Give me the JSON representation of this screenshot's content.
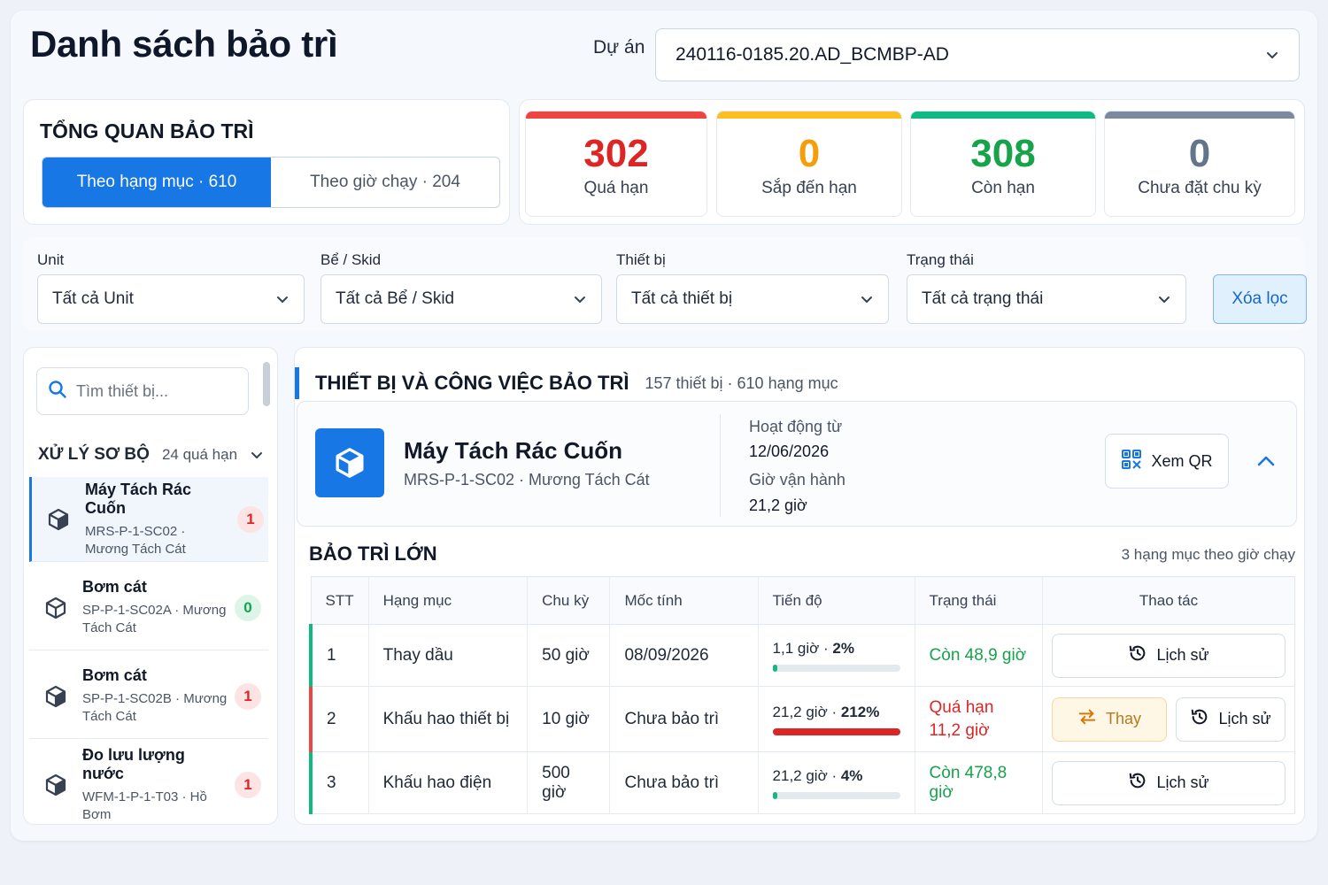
{
  "header": {
    "title": "Danh sách bảo trì",
    "project_label": "Dự án",
    "project_value": "240116-0185.20.AD_BCMBP-AD"
  },
  "overview": {
    "title": "TỔNG QUAN BẢO TRÌ",
    "tab_active": "Theo hạng mục · 610",
    "tab_inactive": "Theo giờ chạy · 204"
  },
  "stats": [
    {
      "value": "302",
      "label": "Quá hạn",
      "color": "#dc2626",
      "bar": "#ef4444"
    },
    {
      "value": "0",
      "label": "Sắp đến hạn",
      "color": "#f59e0b",
      "bar": "#fbbf24"
    },
    {
      "value": "308",
      "label": "Còn hạn",
      "color": "#16a34a",
      "bar": "#10b981"
    },
    {
      "value": "0",
      "label": "Chưa đặt chu kỳ",
      "color": "#64748b",
      "bar": "#7c8a9e"
    }
  ],
  "filters": {
    "unit_label": "Unit",
    "unit_value": "Tất cả Unit",
    "skid_label": "Bể / Skid",
    "skid_value": "Tất cả Bể / Skid",
    "device_label": "Thiết bị",
    "device_value": "Tất cả thiết bị",
    "status_label": "Trạng thái",
    "status_value": "Tất cả trạng thái",
    "clear_label": "Xóa lọc"
  },
  "sidebar": {
    "search_placeholder": "Tìm thiết bị...",
    "group_title": "XỬ LÝ SƠ BỘ",
    "group_count": "24 quá hạn",
    "items": [
      {
        "name": "Máy Tách Rác Cuốn",
        "sub": "MRS-P-1-SC02 · Mương Tách Cát",
        "badge": "1"
      },
      {
        "name": "Bơm cát",
        "sub": "SP-P-1-SC02A · Mương Tách Cát",
        "badge": "0"
      },
      {
        "name": "Bơm cát",
        "sub": "SP-P-1-SC02B · Mương Tách Cát",
        "badge": "1"
      },
      {
        "name": "Đo lưu lượng nước",
        "sub": "WFM-1-P-1-T03 · Hồ Bơm",
        "badge": "1"
      }
    ]
  },
  "main": {
    "section_title": "THIẾT BỊ VÀ CÔNG VIỆC BẢO TRÌ",
    "section_count": "157 thiết bị · 610 hạng mục",
    "device": {
      "name": "Máy Tách Rác Cuốn",
      "sub": "MRS-P-1-SC02 · Mương Tách Cát",
      "active_from_label": "Hoạt động từ",
      "active_from": "12/06/2026",
      "runtime_label": "Giờ vận hành",
      "runtime": "21,2 giờ",
      "qr_label": "Xem QR"
    },
    "big_title": "BẢO TRÌ LỚN",
    "big_count": "3 hạng mục theo giờ chạy",
    "columns": [
      "STT",
      "Hạng mục",
      "Chu kỳ",
      "Mốc tính",
      "Tiến độ",
      "Trạng thái",
      "Thao tác"
    ],
    "rows": [
      {
        "stt": "1",
        "item": "Thay dầu",
        "cycle": "50 giờ",
        "base": "08/09/2026",
        "prog_hours": "1,1 giờ",
        "prog_pct": "2%",
        "fraction": 0.02,
        "status": "Còn 48,9 giờ",
        "state": "ok"
      },
      {
        "stt": "2",
        "item": "Khấu hao thiết bị",
        "cycle": "10 giờ",
        "base": "Chưa bảo trì",
        "prog_hours": "21,2 giờ",
        "prog_pct": "212%",
        "fraction": 1.0,
        "status": "Quá hạn 11,2 giờ",
        "state": "overdue"
      },
      {
        "stt": "3",
        "item": "Khấu hao điện",
        "cycle": "500 giờ",
        "base": "Chưa bảo trì",
        "prog_hours": "21,2 giờ",
        "prog_pct": "4%",
        "fraction": 0.04,
        "status": "Còn 478,8 giờ",
        "state": "ok"
      }
    ],
    "history_label": "Lịch sử",
    "replace_label": "Thay"
  },
  "icons": {
    "project_dropdown": "chevron-down-icon",
    "search": "search-icon",
    "device": "cube-icon",
    "qr": "qr-code-icon",
    "collapse": "chevron-up-icon",
    "history": "history-icon",
    "replace": "swap-icon"
  }
}
